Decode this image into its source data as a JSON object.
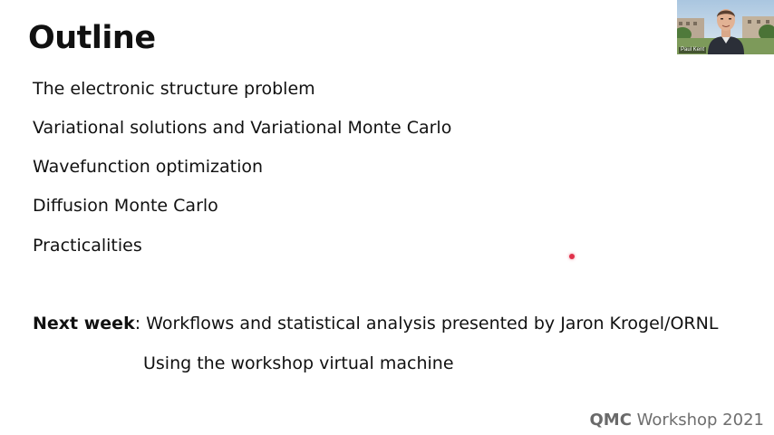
{
  "slide": {
    "title": "Outline",
    "bullets": [
      "The electronic structure problem",
      "Variational solutions and Variational Monte Carlo",
      "Wavefunction optimization",
      "Diffusion Monte Carlo",
      "Practicalities"
    ],
    "next_week": {
      "label": "Next week",
      "text": ": Workflows and statistical analysis presented by Jaron Krogel/ORNL",
      "sub": "Using the workshop virtual machine"
    },
    "footer": {
      "brand": "QMC",
      "rest": " Workshop 2021"
    }
  },
  "video": {
    "participant_name": "Paul Kent"
  },
  "colors": {
    "text": "#111111",
    "footer": "#6e6e6e",
    "pointer": "#e0304a"
  }
}
